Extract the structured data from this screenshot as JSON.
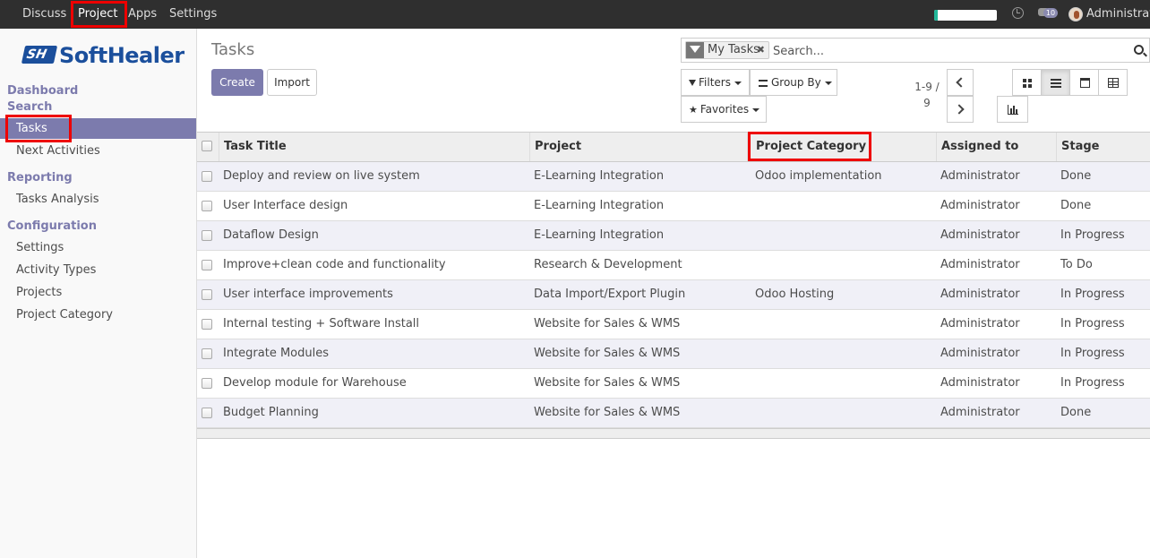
{
  "topnav": {
    "items": [
      "Discuss",
      "Project",
      "Apps",
      "Settings"
    ],
    "user_name": "Administrator",
    "message_count": "10",
    "progress_fraction": 0.06
  },
  "sidebar": {
    "logo_text": "SoftHealer",
    "sections": [
      {
        "label": "Dashboard"
      },
      {
        "label": "Search"
      },
      {
        "label": "Reporting"
      },
      {
        "label": "Configuration"
      }
    ],
    "items": {
      "tasks": "Tasks",
      "next_activities": "Next Activities",
      "tasks_analysis": "Tasks Analysis",
      "settings": "Settings",
      "activity_types": "Activity Types",
      "projects": "Projects",
      "project_category": "Project Category"
    }
  },
  "main": {
    "title": "Tasks",
    "create_label": "Create",
    "import_label": "Import",
    "search": {
      "facet": "My Tasks",
      "placeholder": "Search..."
    },
    "filters_label": "Filters",
    "group_by_label": "Group By",
    "favorites_label": "Favorites",
    "pager": {
      "range": "1-9 /",
      "total": "9"
    }
  },
  "table": {
    "columns": [
      "Task Title",
      "Project",
      "Project Category",
      "Assigned to",
      "Stage"
    ],
    "rows": [
      [
        "Deploy and review on live system",
        "E-Learning Integration",
        "Odoo implementation",
        "Administrator",
        "Done"
      ],
      [
        "User Interface design",
        "E-Learning Integration",
        "",
        "Administrator",
        "Done"
      ],
      [
        "Dataflow Design",
        "E-Learning Integration",
        "",
        "Administrator",
        "In Progress"
      ],
      [
        "Improve+clean code and functionality",
        "Research & Development",
        "",
        "Administrator",
        "To Do"
      ],
      [
        "User interface improvements",
        "Data Import/Export Plugin",
        "Odoo Hosting",
        "Administrator",
        "In Progress"
      ],
      [
        "Internal testing + Software Install",
        "Website for Sales & WMS",
        "",
        "Administrator",
        "In Progress"
      ],
      [
        "Integrate Modules",
        "Website for Sales & WMS",
        "",
        "Administrator",
        "In Progress"
      ],
      [
        "Develop module for Warehouse",
        "Website for Sales & WMS",
        "",
        "Administrator",
        "In Progress"
      ],
      [
        "Budget Planning",
        "Website for Sales & WMS",
        "",
        "Administrator",
        "Done"
      ]
    ]
  },
  "colors": {
    "accent": "#7c7bad",
    "topbar": "#2f2f2f",
    "highlight": "#e00000"
  }
}
